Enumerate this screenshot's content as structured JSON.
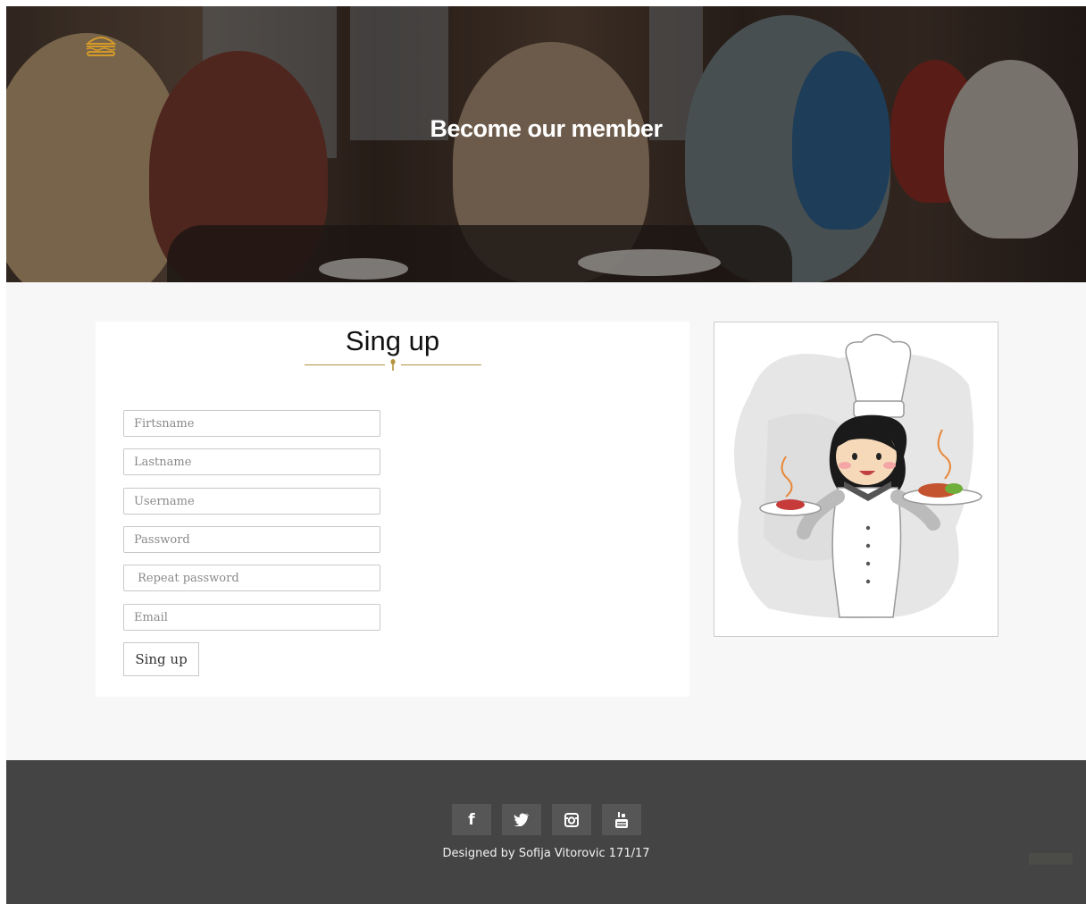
{
  "hero": {
    "title": "Become our member",
    "logo_icon": "burger-icon"
  },
  "form": {
    "title": "Sing up",
    "fields": [
      {
        "name": "firstname",
        "placeholder": "Firtsname"
      },
      {
        "name": "lastname",
        "placeholder": "Lastname"
      },
      {
        "name": "username",
        "placeholder": "Username"
      },
      {
        "name": "password",
        "placeholder": "Password"
      },
      {
        "name": "repeat_password",
        "placeholder": " Repeat password"
      },
      {
        "name": "email",
        "placeholder": "Email"
      }
    ],
    "submit_label": "Sing up"
  },
  "footer": {
    "social": [
      {
        "name": "facebook",
        "glyph": "f"
      },
      {
        "name": "twitter",
        "glyph": "twitter-icon"
      },
      {
        "name": "instagram",
        "glyph": "instagram-icon"
      },
      {
        "name": "youtube",
        "glyph": "youtube-icon"
      }
    ],
    "credit": "Designed by Sofija Vitorovic 171/17"
  },
  "colors": {
    "accent": "#b8923e",
    "footer_bg": "#444444",
    "page_bg": "#f7f7f7"
  }
}
